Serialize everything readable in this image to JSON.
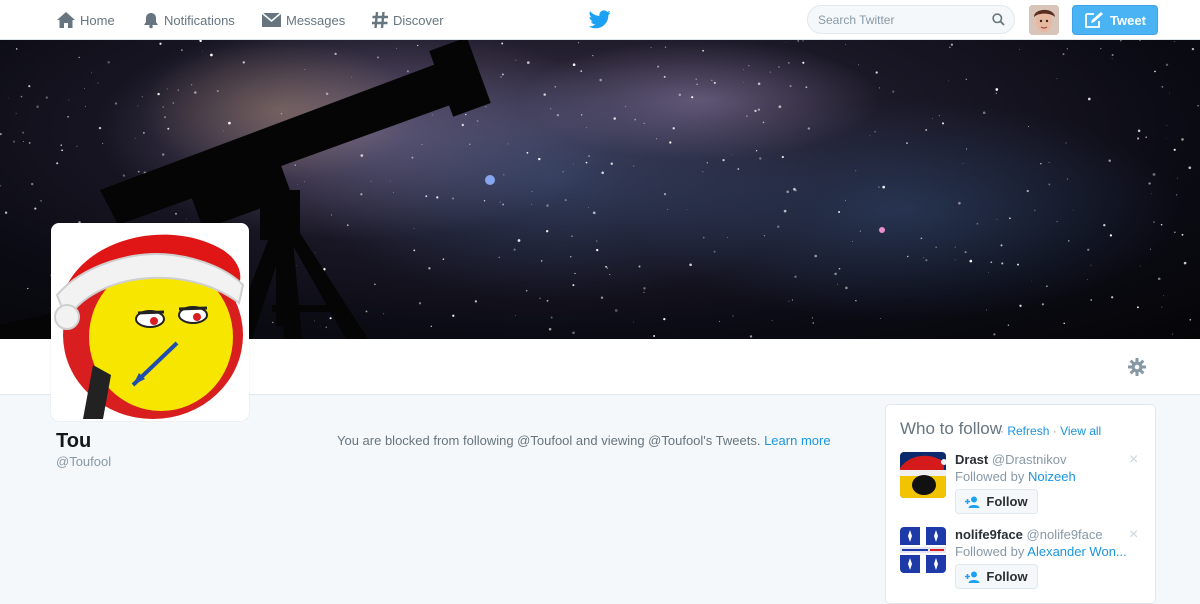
{
  "nav": {
    "home": "Home",
    "notifications": "Notifications",
    "messages": "Messages",
    "discover": "Discover",
    "search_placeholder": "Search Twitter",
    "tweet_button": "Tweet"
  },
  "profile": {
    "name": "Tou",
    "handle": "@Toufool",
    "blocked_message": "You are blocked from following @Toufool and viewing @Toufool's Tweets.",
    "learn_more": "Learn more"
  },
  "who_to_follow": {
    "title": "Who to follow",
    "refresh": "Refresh",
    "separator": "·",
    "view_all": "View all",
    "followed_by_prefix": "Followed by",
    "follow_label": "Follow",
    "close_glyph": "×",
    "suggestions": [
      {
        "name": "Drast",
        "handle": "@Drastnikov",
        "followed_by": "Noizeeh"
      },
      {
        "name": "nolife9face",
        "handle": "@nolife9face",
        "followed_by": "Alexander Won..."
      }
    ]
  },
  "colors": {
    "accent": "#1b95e0",
    "tweet_button": "#4ab3f4",
    "nav_text": "#66757f"
  },
  "icons": {
    "home": "home-icon",
    "notifications": "bell-icon",
    "messages": "envelope-icon",
    "discover": "hashtag-icon",
    "logo": "twitter-bird-icon",
    "search": "search-icon",
    "compose": "compose-icon",
    "settings": "gear-icon",
    "follow": "add-person-icon"
  }
}
